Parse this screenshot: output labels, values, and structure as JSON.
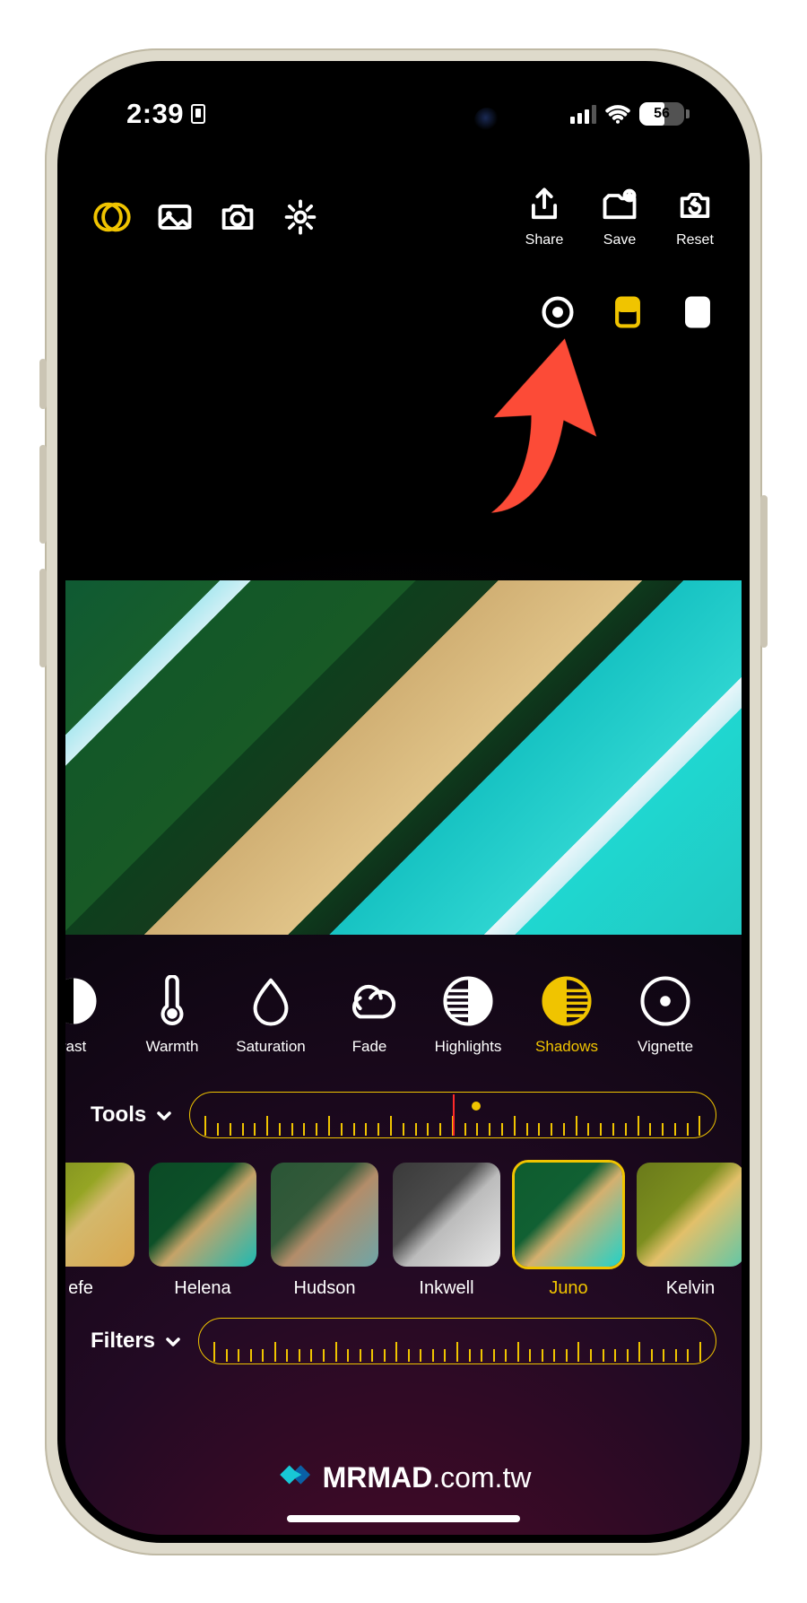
{
  "status": {
    "time": "2:39",
    "battery": "56"
  },
  "toolbar": {
    "share_label": "Share",
    "save_label": "Save",
    "reset_label": "Reset"
  },
  "tools_section": {
    "label": "Tools"
  },
  "tools": [
    {
      "label": "rast"
    },
    {
      "label": "Warmth"
    },
    {
      "label": "Saturation"
    },
    {
      "label": "Fade"
    },
    {
      "label": "Highlights"
    },
    {
      "label": "Shadows"
    },
    {
      "label": "Vignette"
    }
  ],
  "filters_section": {
    "label": "Filters"
  },
  "filters": [
    {
      "label": "efe"
    },
    {
      "label": "Helena"
    },
    {
      "label": "Hudson"
    },
    {
      "label": "Inkwell"
    },
    {
      "label": "Juno"
    },
    {
      "label": "Kelvin"
    }
  ],
  "watermark": {
    "brand": "MRMAD",
    "domain": ".com.tw"
  },
  "colors": {
    "accent": "#f0c400",
    "annotation": "#fc4b37"
  }
}
